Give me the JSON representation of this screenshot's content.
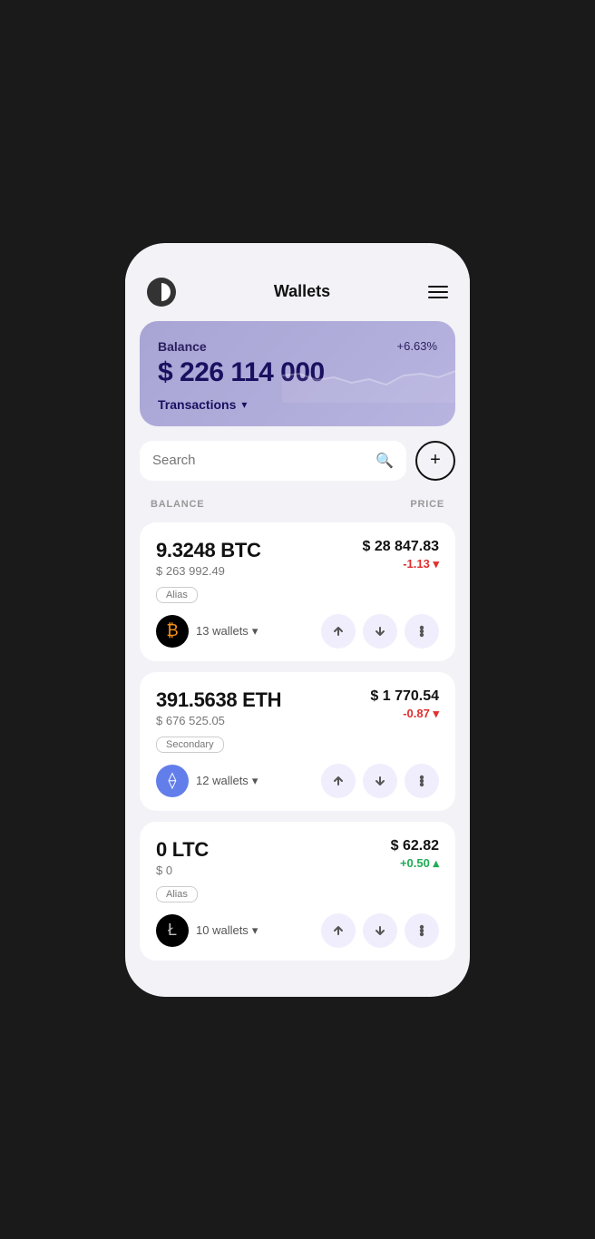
{
  "header": {
    "title": "Wallets",
    "menu_label": "Menu"
  },
  "balance_card": {
    "label": "Balance",
    "amount": "$ 226 114 000",
    "percent": "+6.63%",
    "transactions_label": "Transactions"
  },
  "search": {
    "placeholder": "Search",
    "add_label": "+"
  },
  "table_headers": {
    "balance": "BALANCE",
    "price": "PRICE"
  },
  "coins": [
    {
      "id": "btc",
      "amount": "9.3248 BTC",
      "usd_value": "$ 263 992.49",
      "tag": "Alias",
      "icon_symbol": "₿",
      "icon_class": "btc",
      "wallets_count": "13 wallets",
      "price": "$ 28 847.83",
      "change": "-1.13 ▾",
      "change_type": "negative"
    },
    {
      "id": "eth",
      "amount": "391.5638 ETH",
      "usd_value": "$ 676 525.05",
      "tag": "Secondary",
      "icon_symbol": "⟠",
      "icon_class": "eth",
      "wallets_count": "12 wallets",
      "price": "$ 1 770.54",
      "change": "-0.87 ▾",
      "change_type": "negative"
    },
    {
      "id": "ltc",
      "amount": "0 LTC",
      "usd_value": "$ 0",
      "tag": "Alias",
      "icon_symbol": "Ł",
      "icon_class": "ltc",
      "wallets_count": "10 wallets",
      "price": "$ 62.82",
      "change": "+0.50 ▴",
      "change_type": "positive"
    }
  ]
}
